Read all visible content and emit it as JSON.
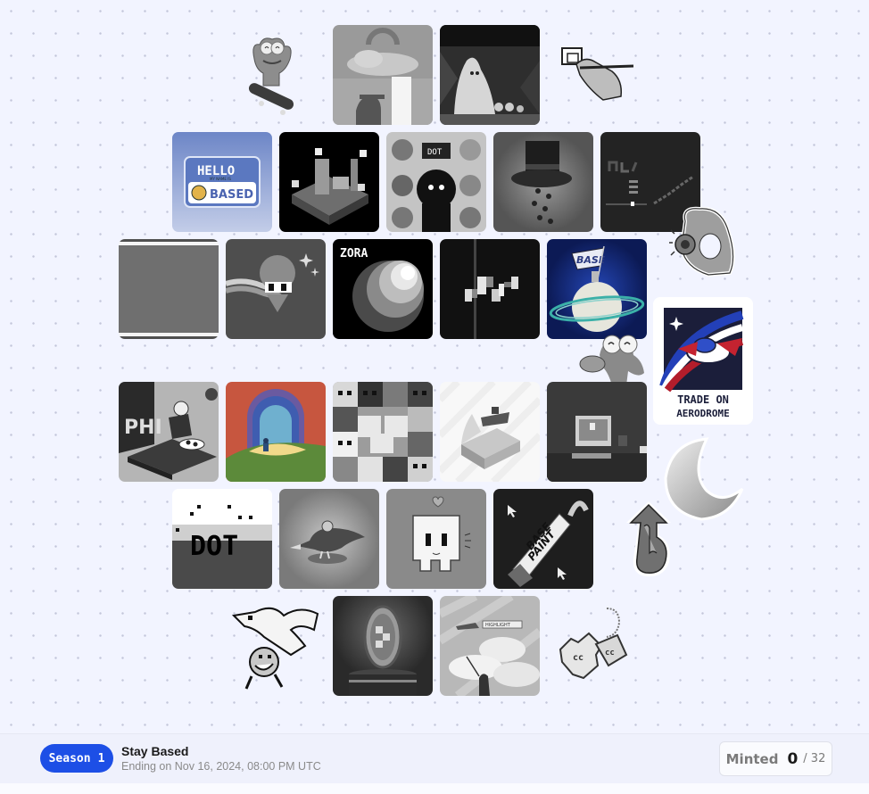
{
  "season": {
    "badge_label": "Season",
    "badge_number": "1",
    "title": "Stay Based",
    "ending": "Ending on Nov 16, 2024, 08:00 PM UTC",
    "accent_color": "#1d4fe6"
  },
  "minted": {
    "label": "Minted",
    "count": "0",
    "total": "/ 32"
  },
  "artworks": {
    "hello_based": {
      "line1": "HELLO",
      "line2": "MY NAME IS",
      "line3": "BASED"
    },
    "zora": {
      "label": "ZORA"
    },
    "dot1": {
      "label": "DOT"
    },
    "dot2": {
      "label": "DOT"
    },
    "base_flag": {
      "label": "BASE"
    },
    "aerodrome": {
      "line1": "TRADE ON",
      "line2": "AERODROME"
    },
    "basepaint": {
      "line1": "BASE",
      "line2": "PAINT"
    },
    "phi": {
      "label": "PHI"
    },
    "highlight": {
      "label": "HIGHLIGHT"
    }
  }
}
